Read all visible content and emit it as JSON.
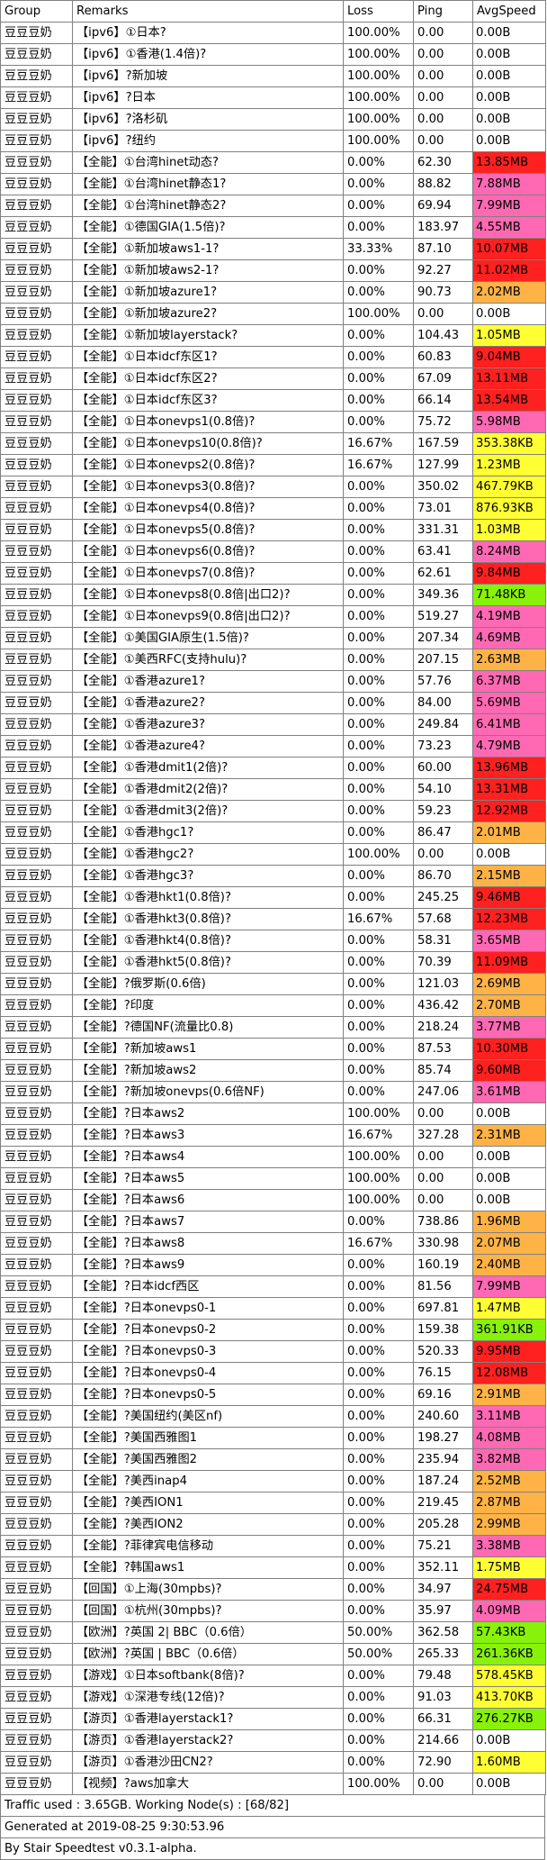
{
  "headers": {
    "group": "Group",
    "remarks": "Remarks",
    "loss": "Loss",
    "ping": "Ping",
    "speed": "AvgSpeed"
  },
  "speed_colors": {
    "red": "#ff2020",
    "pink": "#ff69b4",
    "orange": "#ffb347",
    "yellow": "#ffff33",
    "green": "#88f20a",
    "none": "#ffffff"
  },
  "rows": [
    [
      "豆豆豆奶",
      "【ipv6】①日本?",
      "100.00%",
      "0.00",
      "0.00B",
      "none"
    ],
    [
      "豆豆豆奶",
      "【ipv6】①香港(1.4倍)?",
      "100.00%",
      "0.00",
      "0.00B",
      "none"
    ],
    [
      "豆豆豆奶",
      "【ipv6】?新加坡",
      "100.00%",
      "0.00",
      "0.00B",
      "none"
    ],
    [
      "豆豆豆奶",
      "【ipv6】?日本",
      "100.00%",
      "0.00",
      "0.00B",
      "none"
    ],
    [
      "豆豆豆奶",
      "【ipv6】?洛杉矶",
      "100.00%",
      "0.00",
      "0.00B",
      "none"
    ],
    [
      "豆豆豆奶",
      "【ipv6】?纽约",
      "100.00%",
      "0.00",
      "0.00B",
      "none"
    ],
    [
      "豆豆豆奶",
      "【全能】①台湾hinet动态?",
      "0.00%",
      "62.30",
      "13.85MB",
      "red"
    ],
    [
      "豆豆豆奶",
      "【全能】①台湾hinet静态1?",
      "0.00%",
      "88.82",
      "7.88MB",
      "pink"
    ],
    [
      "豆豆豆奶",
      "【全能】①台湾hinet静态2?",
      "0.00%",
      "69.94",
      "7.99MB",
      "pink"
    ],
    [
      "豆豆豆奶",
      "【全能】①德国GIA(1.5倍)?",
      "0.00%",
      "183.97",
      "4.55MB",
      "pink"
    ],
    [
      "豆豆豆奶",
      "【全能】①新加坡aws1-1?",
      "33.33%",
      "87.10",
      "10.07MB",
      "red"
    ],
    [
      "豆豆豆奶",
      "【全能】①新加坡aws2-1?",
      "0.00%",
      "92.27",
      "11.02MB",
      "red"
    ],
    [
      "豆豆豆奶",
      "【全能】①新加坡azure1?",
      "0.00%",
      "90.73",
      "2.02MB",
      "orange"
    ],
    [
      "豆豆豆奶",
      "【全能】①新加坡azure2?",
      "100.00%",
      "0.00",
      "0.00B",
      "none"
    ],
    [
      "豆豆豆奶",
      "【全能】①新加坡layerstack?",
      "0.00%",
      "104.43",
      "1.05MB",
      "yellow"
    ],
    [
      "豆豆豆奶",
      "【全能】①日本idcf东区1?",
      "0.00%",
      "60.83",
      "9.04MB",
      "red"
    ],
    [
      "豆豆豆奶",
      "【全能】①日本idcf东区2?",
      "0.00%",
      "67.09",
      "13.11MB",
      "red"
    ],
    [
      "豆豆豆奶",
      "【全能】①日本idcf东区3?",
      "0.00%",
      "66.14",
      "13.54MB",
      "red"
    ],
    [
      "豆豆豆奶",
      "【全能】①日本onevps1(0.8倍)?",
      "0.00%",
      "75.72",
      "5.98MB",
      "pink"
    ],
    [
      "豆豆豆奶",
      "【全能】①日本onevps10(0.8倍)?",
      "16.67%",
      "167.59",
      "353.38KB",
      "yellow"
    ],
    [
      "豆豆豆奶",
      "【全能】①日本onevps2(0.8倍)?",
      "16.67%",
      "127.99",
      "1.23MB",
      "yellow"
    ],
    [
      "豆豆豆奶",
      "【全能】①日本onevps3(0.8倍)?",
      "0.00%",
      "350.02",
      "467.79KB",
      "yellow"
    ],
    [
      "豆豆豆奶",
      "【全能】①日本onevps4(0.8倍)?",
      "0.00%",
      "73.01",
      "876.93KB",
      "yellow"
    ],
    [
      "豆豆豆奶",
      "【全能】①日本onevps5(0.8倍)?",
      "0.00%",
      "331.31",
      "1.03MB",
      "yellow"
    ],
    [
      "豆豆豆奶",
      "【全能】①日本onevps6(0.8倍)?",
      "0.00%",
      "63.41",
      "8.24MB",
      "pink"
    ],
    [
      "豆豆豆奶",
      "【全能】①日本onevps7(0.8倍)?",
      "0.00%",
      "62.61",
      "9.84MB",
      "red"
    ],
    [
      "豆豆豆奶",
      "【全能】①日本onevps8(0.8倍|出口2)?",
      "0.00%",
      "349.36",
      "71.48KB",
      "green"
    ],
    [
      "豆豆豆奶",
      "【全能】①日本onevps9(0.8倍|出口2)?",
      "0.00%",
      "519.27",
      "4.19MB",
      "pink"
    ],
    [
      "豆豆豆奶",
      "【全能】①美国GIA原生(1.5倍)?",
      "0.00%",
      "207.34",
      "4.69MB",
      "pink"
    ],
    [
      "豆豆豆奶",
      "【全能】①美西RFC(支持hulu)?",
      "0.00%",
      "207.15",
      "2.63MB",
      "orange"
    ],
    [
      "豆豆豆奶",
      "【全能】①香港azure1?",
      "0.00%",
      "57.76",
      "6.37MB",
      "pink"
    ],
    [
      "豆豆豆奶",
      "【全能】①香港azure2?",
      "0.00%",
      "84.00",
      "5.69MB",
      "pink"
    ],
    [
      "豆豆豆奶",
      "【全能】①香港azure3?",
      "0.00%",
      "249.84",
      "6.41MB",
      "pink"
    ],
    [
      "豆豆豆奶",
      "【全能】①香港azure4?",
      "0.00%",
      "73.23",
      "4.79MB",
      "pink"
    ],
    [
      "豆豆豆奶",
      "【全能】①香港dmit1(2倍)?",
      "0.00%",
      "60.00",
      "13.96MB",
      "red"
    ],
    [
      "豆豆豆奶",
      "【全能】①香港dmit2(2倍)?",
      "0.00%",
      "54.10",
      "13.31MB",
      "red"
    ],
    [
      "豆豆豆奶",
      "【全能】①香港dmit3(2倍)?",
      "0.00%",
      "59.23",
      "12.92MB",
      "red"
    ],
    [
      "豆豆豆奶",
      "【全能】①香港hgc1?",
      "0.00%",
      "86.47",
      "2.01MB",
      "orange"
    ],
    [
      "豆豆豆奶",
      "【全能】①香港hgc2?",
      "100.00%",
      "0.00",
      "0.00B",
      "none"
    ],
    [
      "豆豆豆奶",
      "【全能】①香港hgc3?",
      "0.00%",
      "86.70",
      "2.15MB",
      "orange"
    ],
    [
      "豆豆豆奶",
      "【全能】①香港hkt1(0.8倍)?",
      "0.00%",
      "245.25",
      "9.46MB",
      "red"
    ],
    [
      "豆豆豆奶",
      "【全能】①香港hkt3(0.8倍)?",
      "16.67%",
      "57.68",
      "12.23MB",
      "red"
    ],
    [
      "豆豆豆奶",
      "【全能】①香港hkt4(0.8倍)?",
      "0.00%",
      "58.31",
      "3.65MB",
      "pink"
    ],
    [
      "豆豆豆奶",
      "【全能】①香港hkt5(0.8倍)?",
      "0.00%",
      "70.39",
      "11.09MB",
      "red"
    ],
    [
      "豆豆豆奶",
      "【全能】?俄罗斯(0.6倍)",
      "0.00%",
      "121.03",
      "2.69MB",
      "orange"
    ],
    [
      "豆豆豆奶",
      "【全能】?印度",
      "0.00%",
      "436.42",
      "2.70MB",
      "orange"
    ],
    [
      "豆豆豆奶",
      "【全能】?德国NF(流量比0.8)",
      "0.00%",
      "218.24",
      "3.77MB",
      "pink"
    ],
    [
      "豆豆豆奶",
      "【全能】?新加坡aws1",
      "0.00%",
      "87.53",
      "10.30MB",
      "red"
    ],
    [
      "豆豆豆奶",
      "【全能】?新加坡aws2",
      "0.00%",
      "85.74",
      "9.60MB",
      "red"
    ],
    [
      "豆豆豆奶",
      "【全能】?新加坡onevps(0.6倍NF)",
      "0.00%",
      "247.06",
      "3.61MB",
      "pink"
    ],
    [
      "豆豆豆奶",
      "【全能】?日本aws2",
      "100.00%",
      "0.00",
      "0.00B",
      "none"
    ],
    [
      "豆豆豆奶",
      "【全能】?日本aws3",
      "16.67%",
      "327.28",
      "2.31MB",
      "orange"
    ],
    [
      "豆豆豆奶",
      "【全能】?日本aws4",
      "100.00%",
      "0.00",
      "0.00B",
      "none"
    ],
    [
      "豆豆豆奶",
      "【全能】?日本aws5",
      "100.00%",
      "0.00",
      "0.00B",
      "none"
    ],
    [
      "豆豆豆奶",
      "【全能】?日本aws6",
      "100.00%",
      "0.00",
      "0.00B",
      "none"
    ],
    [
      "豆豆豆奶",
      "【全能】?日本aws7",
      "0.00%",
      "738.86",
      "1.96MB",
      "orange"
    ],
    [
      "豆豆豆奶",
      "【全能】?日本aws8",
      "16.67%",
      "330.98",
      "2.07MB",
      "orange"
    ],
    [
      "豆豆豆奶",
      "【全能】?日本aws9",
      "0.00%",
      "160.19",
      "2.40MB",
      "orange"
    ],
    [
      "豆豆豆奶",
      "【全能】?日本idcf西区",
      "0.00%",
      "81.56",
      "7.99MB",
      "pink"
    ],
    [
      "豆豆豆奶",
      "【全能】?日本onevps0-1",
      "0.00%",
      "697.81",
      "1.47MB",
      "yellow"
    ],
    [
      "豆豆豆奶",
      "【全能】?日本onevps0-2",
      "0.00%",
      "159.38",
      "361.91KB",
      "green"
    ],
    [
      "豆豆豆奶",
      "【全能】?日本onevps0-3",
      "0.00%",
      "520.33",
      "9.95MB",
      "red"
    ],
    [
      "豆豆豆奶",
      "【全能】?日本onevps0-4",
      "0.00%",
      "76.15",
      "12.08MB",
      "red"
    ],
    [
      "豆豆豆奶",
      "【全能】?日本onevps0-5",
      "0.00%",
      "69.16",
      "2.91MB",
      "orange"
    ],
    [
      "豆豆豆奶",
      "【全能】?美国纽约(美区nf)",
      "0.00%",
      "240.60",
      "3.11MB",
      "pink"
    ],
    [
      "豆豆豆奶",
      "【全能】?美国西雅图1",
      "0.00%",
      "198.27",
      "4.08MB",
      "pink"
    ],
    [
      "豆豆豆奶",
      "【全能】?美国西雅图2",
      "0.00%",
      "235.94",
      "3.82MB",
      "pink"
    ],
    [
      "豆豆豆奶",
      "【全能】?美西inap4",
      "0.00%",
      "187.24",
      "2.52MB",
      "orange"
    ],
    [
      "豆豆豆奶",
      "【全能】?美西ION1",
      "0.00%",
      "219.45",
      "2.87MB",
      "orange"
    ],
    [
      "豆豆豆奶",
      "【全能】?美西ION2",
      "0.00%",
      "205.28",
      "2.99MB",
      "orange"
    ],
    [
      "豆豆豆奶",
      "【全能】?菲律宾电信移动",
      "0.00%",
      "75.21",
      "3.38MB",
      "pink"
    ],
    [
      "豆豆豆奶",
      "【全能】?韩国aws1",
      "0.00%",
      "352.11",
      "1.75MB",
      "yellow"
    ],
    [
      "豆豆豆奶",
      "【回国】①上海(30mpbs)?",
      "0.00%",
      "34.97",
      "24.75MB",
      "red"
    ],
    [
      "豆豆豆奶",
      "【回国】①杭州(30mpbs)?",
      "0.00%",
      "35.97",
      "4.09MB",
      "pink"
    ],
    [
      "豆豆豆奶",
      "【欧洲】?英国 2| BBC（0.6倍）",
      "50.00%",
      "362.58",
      "57.43KB",
      "green"
    ],
    [
      "豆豆豆奶",
      "【欧洲】?英国 | BBC（0.6倍）",
      "50.00%",
      "265.33",
      "261.36KB",
      "green"
    ],
    [
      "豆豆豆奶",
      "【游戏】①日本softbank(8倍)?",
      "0.00%",
      "79.48",
      "578.45KB",
      "yellow"
    ],
    [
      "豆豆豆奶",
      "【游戏】①深港专线(12倍)?",
      "0.00%",
      "91.03",
      "413.70KB",
      "yellow"
    ],
    [
      "豆豆豆奶",
      "【游页】①香港layerstack1?",
      "0.00%",
      "66.31",
      "276.27KB",
      "green"
    ],
    [
      "豆豆豆奶",
      "【游页】①香港layerstack2?",
      "0.00%",
      "214.66",
      "0.00B",
      "none"
    ],
    [
      "豆豆豆奶",
      "【游页】①香港沙田CN2?",
      "0.00%",
      "72.90",
      "1.60MB",
      "yellow"
    ],
    [
      "豆豆豆奶",
      "【视频】?aws加拿大",
      "100.00%",
      "0.00",
      "0.00B",
      "none"
    ]
  ],
  "footer": {
    "traffic": "Traffic used : 3.65GB. Working Node(s) : [68/82]",
    "generated": "Generated at 2019-08-25 9:30:53.96",
    "by": "By Stair Speedtest v0.3.1-alpha."
  }
}
